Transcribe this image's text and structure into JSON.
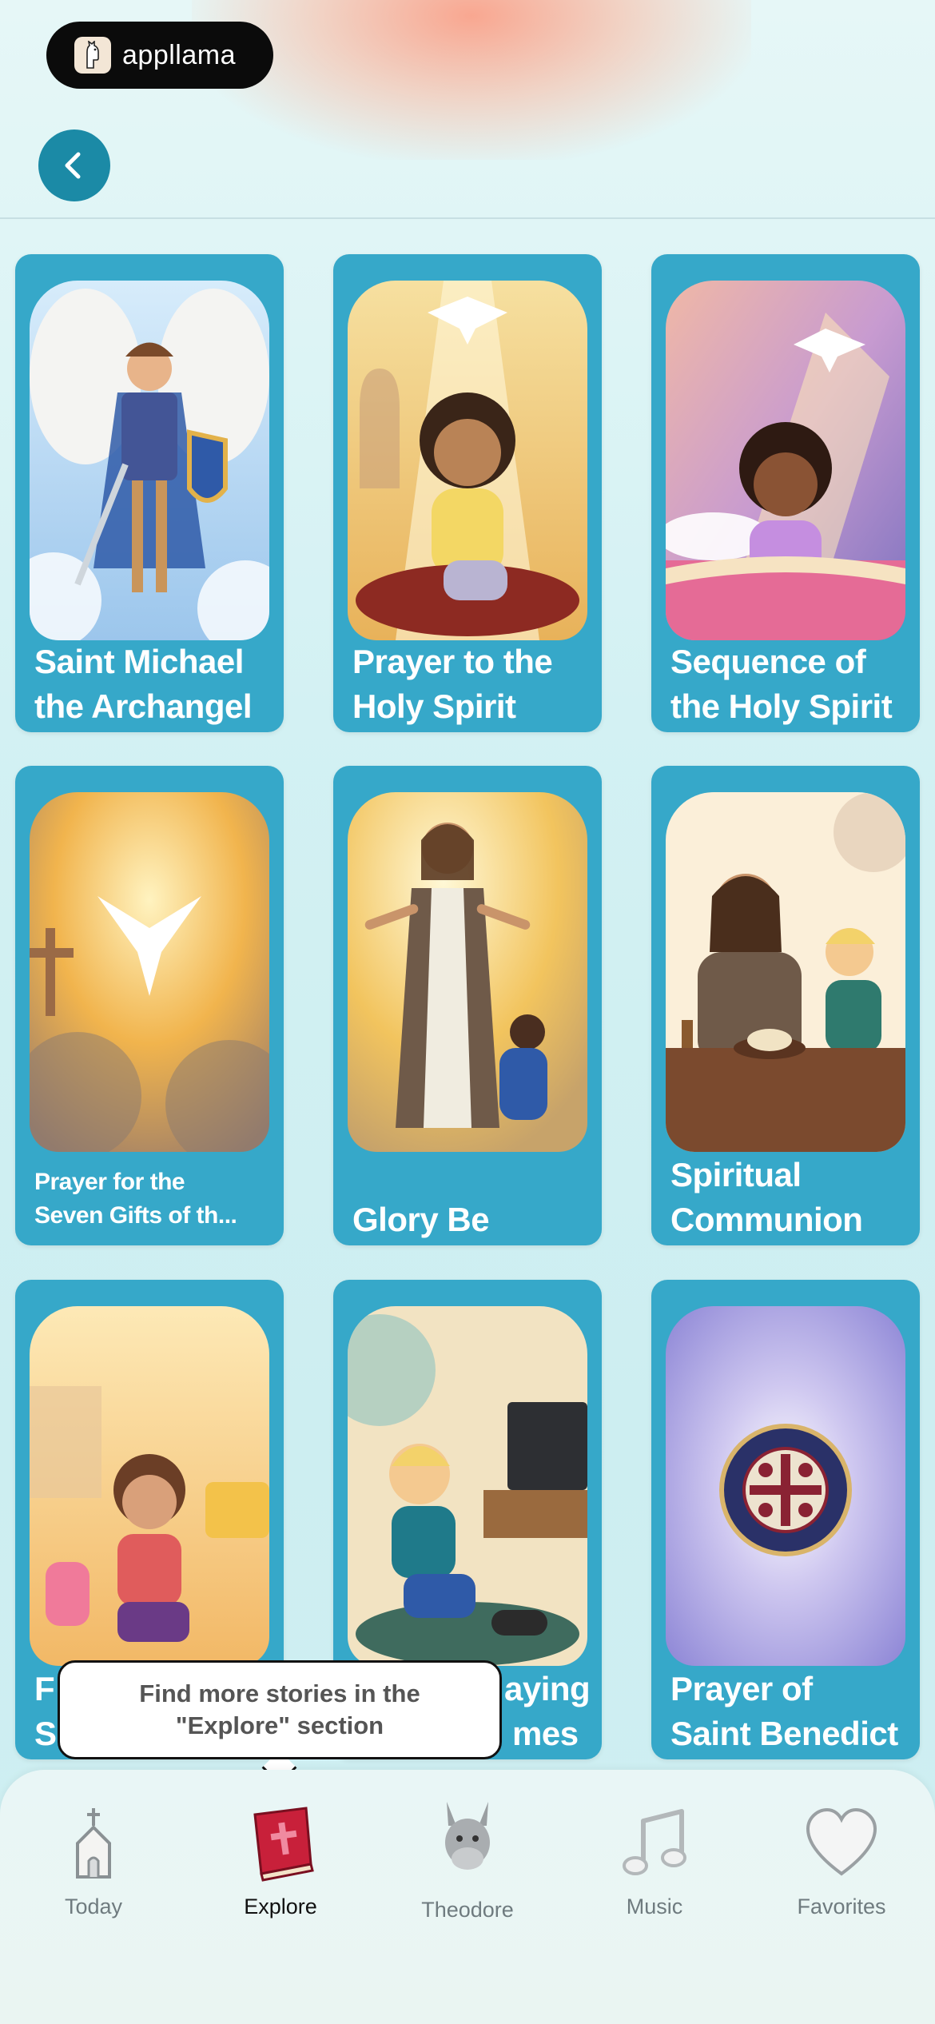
{
  "brand": {
    "name": "appllama"
  },
  "nav": {
    "back_icon": "chevron-left-icon"
  },
  "cards": [
    {
      "title_line1": "Saint Michael",
      "title_line2": "the Archangel"
    },
    {
      "title_line1": "Prayer to the",
      "title_line2": "Holy Spirit"
    },
    {
      "title_line1": "Sequence of",
      "title_line2": "the Holy Spirit"
    },
    {
      "title_line1": "Prayer for the",
      "title_line2": "Seven Gifts of th..."
    },
    {
      "title_line1": "Glory Be",
      "title_line2": ""
    },
    {
      "title_line1": "Spiritual",
      "title_line2": "Communion"
    },
    {
      "title_line1": "F",
      "title_line2": "S"
    },
    {
      "title_line1": "aying",
      "title_line2": "mes"
    },
    {
      "title_line1": "Prayer of",
      "title_line2": "Saint Benedict"
    }
  ],
  "tooltip": {
    "line1": "Find more stories in the",
    "line2": "\"Explore\" section"
  },
  "tabs": [
    {
      "label": "Today",
      "icon": "church-icon"
    },
    {
      "label": "Explore",
      "icon": "book-icon"
    },
    {
      "label": "Theodore",
      "icon": "donkey-icon"
    },
    {
      "label": "Music",
      "icon": "music-note-icon"
    },
    {
      "label": "Favorites",
      "icon": "heart-icon"
    }
  ],
  "colors": {
    "accent": "#1b8aa6",
    "card": "#36a8c9",
    "book": "#c8203a"
  }
}
